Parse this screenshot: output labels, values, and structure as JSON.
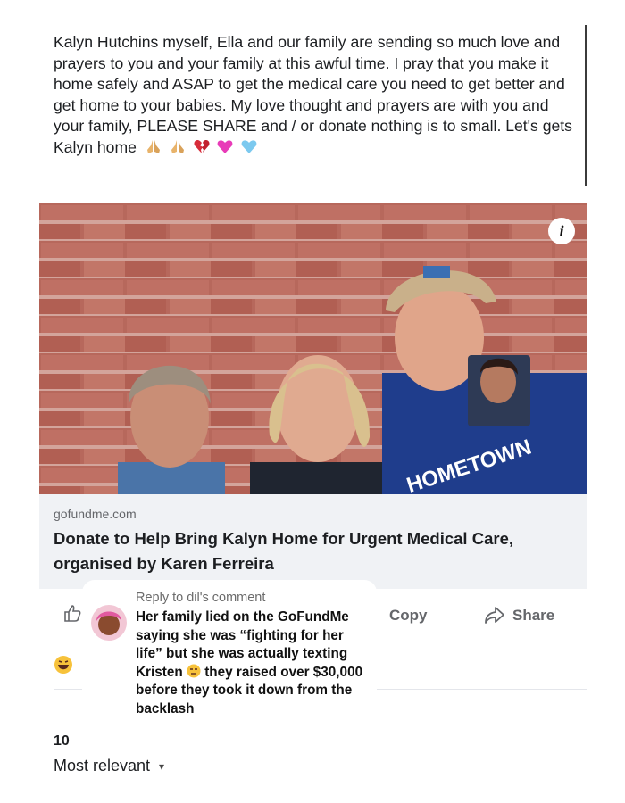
{
  "post": {
    "body": "Kalyn Hutchins myself,  Ella and our family are sending so much love and prayers to you and your family at this awful time. I pray that you make it home safely and ASAP to get the medical care you need to get better and get home to your babies. My love thought and prayers are with you and your family, PLEASE SHARE and / or donate nothing is to small. Let's gets Kalyn home",
    "emojis": [
      "folded-hands-icon",
      "folded-hands-icon",
      "broken-heart-icon",
      "pink-heart-icon",
      "light-blue-heart-icon"
    ]
  },
  "photo": {
    "info_icon": "i",
    "shirt_text": "HOMETOWN"
  },
  "link": {
    "domain": "gofundme.com",
    "title": "Donate to Help Bring Kalyn Home for Urgent Medical Care, organised by Karen Ferreira"
  },
  "actions": {
    "copy": "Copy",
    "share": "Share"
  },
  "reactions": {
    "count": "10"
  },
  "comments": {
    "sort": "Most relevant"
  },
  "overlay": {
    "reply_to": "Reply to dil's comment",
    "text_before": "Her family lied on the GoFundMe saying she was “fighting for her life” but she was actually texting Kristen",
    "text_after": "they raised over $30,000 before they took it down from the backlash"
  },
  "colors": {
    "brick": "#b6665b",
    "link_card_bg": "#f0f2f5",
    "muted": "#65676b"
  }
}
